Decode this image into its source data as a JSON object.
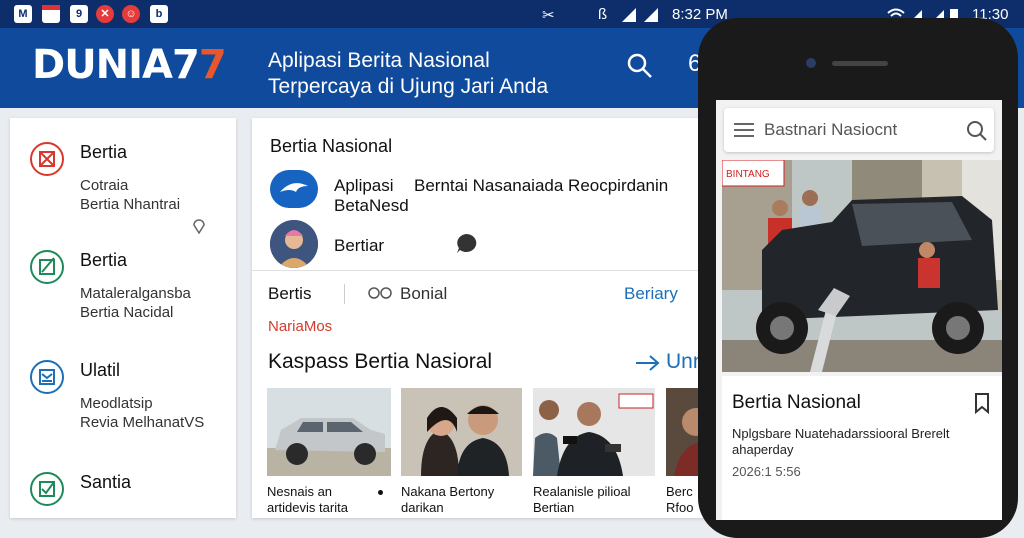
{
  "statusbar": {
    "time_left": "8:32 PM",
    "time_right": "11:30"
  },
  "header": {
    "logo_main": "DUNIA7",
    "logo_accent": "7",
    "tagline_line1": "Aplipasi Berita Nasional",
    "tagline_line2": "Terpercaya di Ujung Jari Anda"
  },
  "sidebar": {
    "items": [
      {
        "title": "Bertia",
        "sub1": "Cotraia",
        "sub2": "Bertia Nhantrai",
        "icon": "close-square-icon",
        "color": "#d8382c"
      },
      {
        "title": "Bertia",
        "sub1": "Mataleralgansba",
        "sub2": "Bertia Nacidal",
        "icon": "edit-square-icon",
        "color": "#1e8a5a"
      },
      {
        "title": "Ulatil",
        "sub1": "Meodlatsip",
        "sub2": "Revia MelhanatVS",
        "icon": "inbox-square-icon",
        "color": "#1c6fb8"
      },
      {
        "title": "Santia",
        "sub1": "",
        "sub2": "",
        "icon": "check-square-icon",
        "color": "#1e8a5a"
      }
    ]
  },
  "main": {
    "title": "Bertia Nasional",
    "row1_name": "Aplipasi",
    "row1_name2": "BetaNesd",
    "row1_desc": "Berntai Nasanaiada Reocpirdanin",
    "row2_name": "Bertiar",
    "tabs": {
      "tab1": "Bertis",
      "tab2": "Bonial",
      "tab3": "Beriary"
    },
    "tag": "NariaMos",
    "section_title": "Kaspass Bertia Nasioral",
    "section_more": "Unn",
    "thumbs": [
      {
        "line1": "Nesnais an",
        "line2": "artidevis tarita"
      },
      {
        "line1": "Nakana Bertony",
        "line2": "darikan"
      },
      {
        "line1": "Realanisle pilioal",
        "line2": "Bertian"
      },
      {
        "line1": "Berc",
        "line2": "Rfoo"
      }
    ]
  },
  "phone": {
    "search_placeholder": "Bastnari Nasiocnt",
    "card_title": "Bertia Nasional",
    "card_desc1": "Nplgsbare Nuatehadarssiooral Brerelt",
    "card_desc2": "ahaperday",
    "card_time": "2026:1 5:56",
    "shop_sign": "BINTANG"
  }
}
